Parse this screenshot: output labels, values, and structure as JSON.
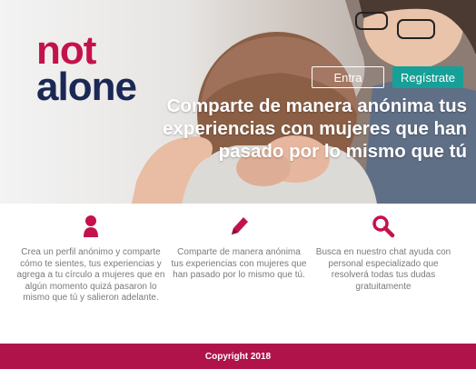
{
  "brand": {
    "logo_line1": "not",
    "logo_line2": "alone"
  },
  "header": {
    "login_label": "Entra",
    "register_label": "Regístrate"
  },
  "hero": {
    "headline": "Comparte de manera anónima tus experiencias con mujeres que han pasado por lo mismo que tú"
  },
  "features": [
    {
      "icon": "user-icon",
      "text": "Crea un perfil anónimo y comparte cómo te sientes, tus experiencias y agrega a tu círculo a mujeres que en algún momento quizá pasaron lo mismo que tú y salieron adelante."
    },
    {
      "icon": "pencil-icon",
      "text": "Comparte de manera anónima tus experiencias con mujeres que han pasado por lo mismo que tú."
    },
    {
      "icon": "search-icon",
      "text": "Busca en nuestro chat ayuda con personal especializado que resolverá todas tus dudas gratuitamente"
    }
  ],
  "footer": {
    "copyright": "Copyright 2018"
  },
  "colors": {
    "brand_red": "#c4124a",
    "brand_navy": "#1b2855",
    "accent_teal": "#17a097",
    "footer_bg": "#b0134a"
  }
}
